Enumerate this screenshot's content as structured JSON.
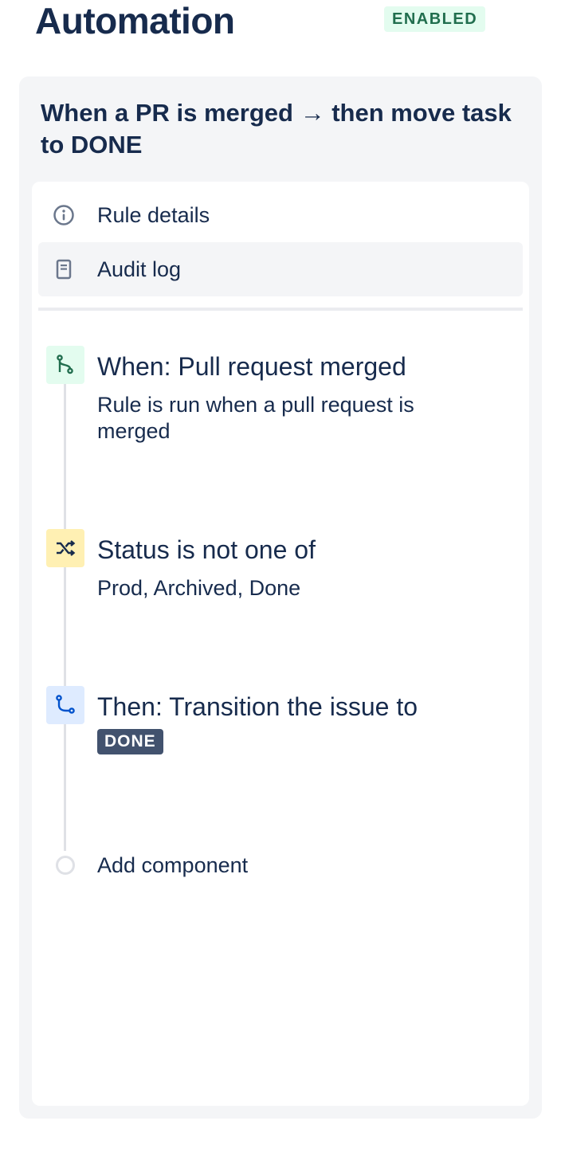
{
  "header": {
    "title": "Automation",
    "status": "ENABLED"
  },
  "rule": {
    "title": "When a PR is merged → then move task to DONE"
  },
  "nav": {
    "items": [
      {
        "label": "Rule details",
        "icon": "info-icon",
        "active": false
      },
      {
        "label": "Audit log",
        "icon": "document-icon",
        "active": true
      }
    ]
  },
  "steps": [
    {
      "type": "trigger",
      "icon": "branch-merge-icon",
      "title": "When: Pull request merged",
      "description": "Rule is run when a pull request is merged",
      "color": "#e3fcef"
    },
    {
      "type": "condition",
      "icon": "shuffle-icon",
      "title": "Status is not one of",
      "description": "Prod, Archived, Done",
      "color": "#fff0b3"
    },
    {
      "type": "action",
      "icon": "transition-icon",
      "title": "Then: Transition the issue to",
      "badge": "DONE",
      "color": "#deebff"
    }
  ],
  "add_component": {
    "label": "Add component"
  },
  "colors": {
    "text": "#172b4d",
    "enabled_bg": "#e3fcef",
    "enabled_text": "#216e4e",
    "done_badge": "#42526e",
    "panel_bg": "#f4f5f7"
  }
}
